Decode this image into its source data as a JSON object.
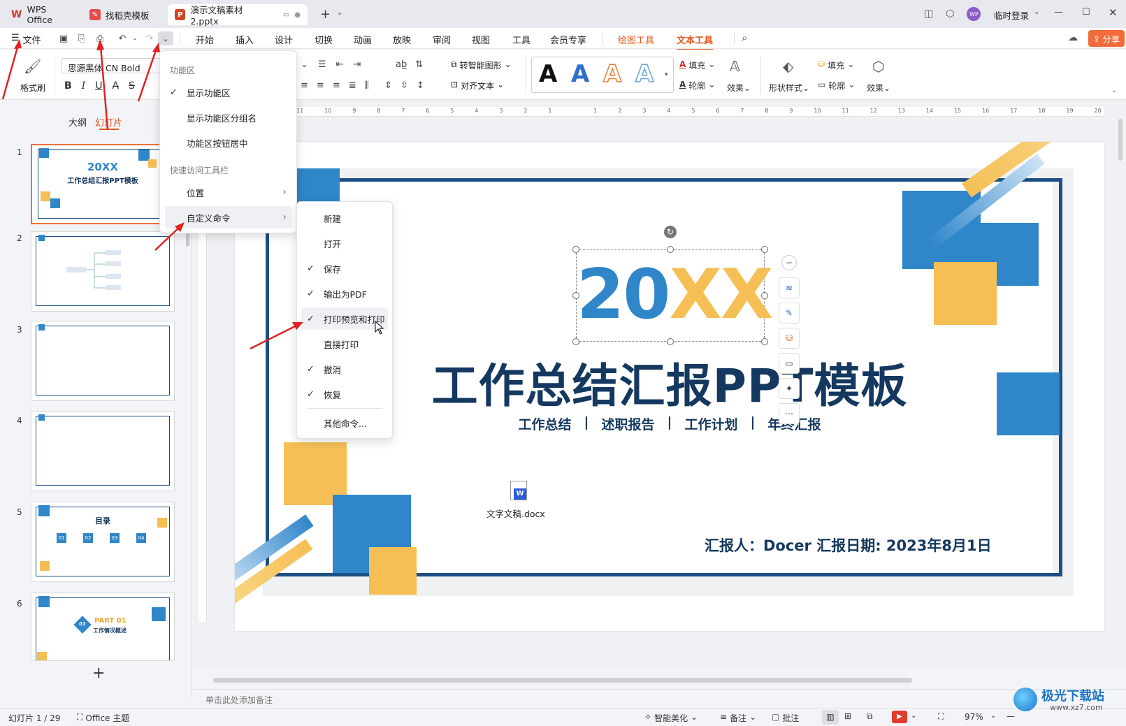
{
  "titlebar": {
    "tabs": [
      {
        "label": "WPS Office"
      },
      {
        "label": "找稻壳模板"
      },
      {
        "label": "演示文稿素材2.pptx"
      }
    ],
    "new_tab": "+",
    "login_label": "临时登录",
    "avatar_text": "WP"
  },
  "menubar": {
    "file_label": "文件",
    "tabs": [
      "开始",
      "插入",
      "设计",
      "切换",
      "动画",
      "放映",
      "审阅",
      "视图",
      "工具",
      "会员专享",
      "绘图工具",
      "文本工具"
    ],
    "share_label": "分享"
  },
  "ribbon": {
    "format_painter": "格式刷",
    "font_name": "思源黑体 CN Bold",
    "smart_shape": "转智能图形",
    "align_text": "对齐文本",
    "fill_label": "填充",
    "outline_label": "轮廓",
    "effect_label": "效果",
    "shape_style": "形状样式",
    "fill2_label": "填充",
    "outline2_label": "轮廓",
    "effect2_label": "效果",
    "wordart_letter": "A"
  },
  "leftpanel": {
    "tabs": [
      "大纲",
      "幻灯片"
    ],
    "slides": [
      {
        "num": "1",
        "title": "20XX",
        "subtitle": "工作总结汇报PPT模板"
      },
      {
        "num": "2"
      },
      {
        "num": "3"
      },
      {
        "num": "4"
      },
      {
        "num": "5",
        "title": "目录",
        "items": [
          "01",
          "02",
          "03",
          "04"
        ]
      },
      {
        "num": "6",
        "title": "PART 01",
        "subtitle": "工作情况概述",
        "badge": "01"
      }
    ],
    "add_label": "+"
  },
  "ruler_numbers": [
    "11",
    "10",
    "9",
    "8",
    "7",
    "6",
    "5",
    "4",
    "3",
    "2",
    "1",
    "",
    "1",
    "2",
    "3",
    "4",
    "5",
    "6",
    "7",
    "8",
    "9",
    "10",
    "11",
    "12",
    "13",
    "14",
    "15",
    "16",
    "17",
    "18",
    "19",
    "20"
  ],
  "slide": {
    "year_blue": "20",
    "year_orange": "XX",
    "title": "工作总结汇报PPT模板",
    "subtitle_items": [
      "工作总结",
      "述职报告",
      "工作计划",
      "年终汇报"
    ],
    "separator": "|",
    "reporter": "汇报人：Docer  汇报日期: 2023年8月1日",
    "attachment": "文字文稿.docx",
    "colors": {
      "blue": "#2f86c9",
      "dark_blue": "#1c4f86",
      "orange": "#f5bf55",
      "navy": "#14385f"
    }
  },
  "dropdown_menu": {
    "section1": "功能区",
    "items1": [
      {
        "label": "显示功能区",
        "checked": true
      },
      {
        "label": "显示功能区分组名",
        "checked": false
      },
      {
        "label": "功能区按钮居中",
        "checked": false
      }
    ],
    "section2": "快速访问工具栏",
    "items2": [
      {
        "label": "位置",
        "submenu": true
      },
      {
        "label": "自定义命令",
        "submenu": true
      }
    ]
  },
  "submenu": {
    "items": [
      {
        "label": "新建",
        "checked": false
      },
      {
        "label": "打开",
        "checked": false
      },
      {
        "label": "保存",
        "checked": true
      },
      {
        "label": "输出为PDF",
        "checked": true
      },
      {
        "label": "打印预览和打印",
        "checked": true
      },
      {
        "label": "直接打印",
        "checked": false
      },
      {
        "label": "撤消",
        "checked": true
      },
      {
        "label": "恢复",
        "checked": true
      }
    ],
    "more": "其他命令..."
  },
  "notes_placeholder": "单击此处添加备注",
  "statusbar": {
    "slide_count": "幻灯片 1 / 29",
    "theme": "Office 主题",
    "smart_beautify": "智能美化",
    "notes": "备注",
    "comments": "批注",
    "zoom": "97%"
  },
  "watermark": {
    "text": "极光下载站",
    "url": "www.xz7.com"
  }
}
